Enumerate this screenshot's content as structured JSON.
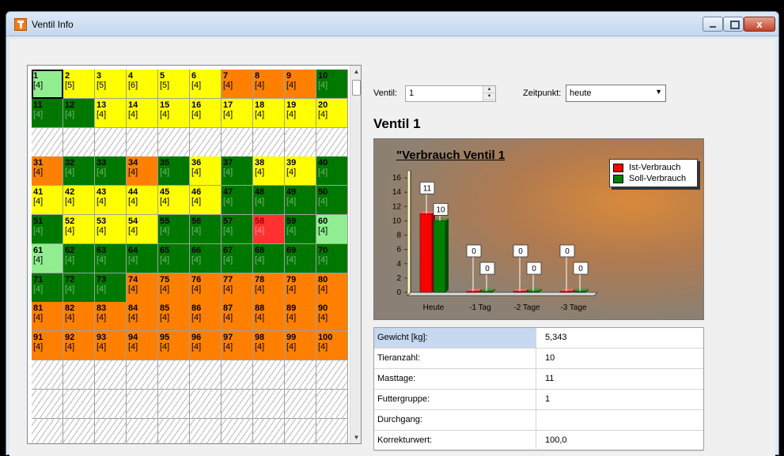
{
  "window": {
    "title": "Ventil Info",
    "close_label": "x"
  },
  "grid": {
    "rows": [
      [
        [
          "1",
          "[4]",
          "sel"
        ],
        [
          "2",
          "[5]",
          "yellow"
        ],
        [
          "3",
          "[5]",
          "yellow"
        ],
        [
          "4",
          "[6]",
          "yellow"
        ],
        [
          "5",
          "[5]",
          "yellow"
        ],
        [
          "6",
          "[4]",
          "yellow"
        ],
        [
          "7",
          "[4]",
          "orange"
        ],
        [
          "8",
          "[4]",
          "orange"
        ],
        [
          "9",
          "[4]",
          "orange"
        ],
        [
          "10",
          "[4]",
          "dgreen"
        ]
      ],
      [
        [
          "11",
          "[4]",
          "dgreen"
        ],
        [
          "12",
          "[4]",
          "dgreen"
        ],
        [
          "13",
          "[4]",
          "yellow"
        ],
        [
          "14",
          "[4]",
          "yellow"
        ],
        [
          "15",
          "[4]",
          "yellow"
        ],
        [
          "16",
          "[4]",
          "yellow"
        ],
        [
          "17",
          "[4]",
          "yellow"
        ],
        [
          "18",
          "[4]",
          "yellow"
        ],
        [
          "19",
          "[4]",
          "yellow"
        ],
        [
          "20",
          "[4]",
          "yellow"
        ]
      ],
      [
        [
          "",
          "",
          "empty"
        ],
        [
          "",
          "",
          "empty"
        ],
        [
          "",
          "",
          "empty"
        ],
        [
          "",
          "",
          "empty"
        ],
        [
          "",
          "",
          "empty"
        ],
        [
          "",
          "",
          "empty"
        ],
        [
          "",
          "",
          "empty"
        ],
        [
          "",
          "",
          "empty"
        ],
        [
          "",
          "",
          "empty"
        ],
        [
          "",
          "",
          "empty"
        ]
      ],
      [
        [
          "31",
          "[4]",
          "orange"
        ],
        [
          "32",
          "[4]",
          "dgreen"
        ],
        [
          "33",
          "[4]",
          "dgreen"
        ],
        [
          "34",
          "[4]",
          "orange"
        ],
        [
          "35",
          "[4]",
          "dgreen"
        ],
        [
          "36",
          "[4]",
          "yellow"
        ],
        [
          "37",
          "[4]",
          "dgreen"
        ],
        [
          "38",
          "[4]",
          "yellow"
        ],
        [
          "39",
          "[4]",
          "yellow"
        ],
        [
          "40",
          "[4]",
          "dgreen"
        ]
      ],
      [
        [
          "41",
          "[4]",
          "yellow"
        ],
        [
          "42",
          "[4]",
          "yellow"
        ],
        [
          "43",
          "[4]",
          "yellow"
        ],
        [
          "44",
          "[4]",
          "yellow"
        ],
        [
          "45",
          "[4]",
          "yellow"
        ],
        [
          "46",
          "[4]",
          "yellow"
        ],
        [
          "47",
          "[4]",
          "dgreen"
        ],
        [
          "48",
          "[4]",
          "dgreen"
        ],
        [
          "49",
          "[4]",
          "dgreen"
        ],
        [
          "50",
          "[4]",
          "dgreen"
        ]
      ],
      [
        [
          "51",
          "[4]",
          "dgreen"
        ],
        [
          "52",
          "[4]",
          "yellow"
        ],
        [
          "53",
          "[4]",
          "yellow"
        ],
        [
          "54",
          "[4]",
          "yellow"
        ],
        [
          "55",
          "[4]",
          "dgreen"
        ],
        [
          "56",
          "[4]",
          "dgreen"
        ],
        [
          "57",
          "[4]",
          "dgreen"
        ],
        [
          "58",
          "[4]",
          "red"
        ],
        [
          "59",
          "[4]",
          "dgreen"
        ],
        [
          "60",
          "[4]",
          "lgreen"
        ]
      ],
      [
        [
          "61",
          "[4]",
          "lgreen"
        ],
        [
          "62",
          "[4]",
          "dgreen"
        ],
        [
          "63",
          "[4]",
          "dgreen"
        ],
        [
          "64",
          "[4]",
          "dgreen"
        ],
        [
          "65",
          "[4]",
          "dgreen"
        ],
        [
          "66",
          "[4]",
          "dgreen"
        ],
        [
          "67",
          "[4]",
          "dgreen"
        ],
        [
          "68",
          "[4]",
          "dgreen"
        ],
        [
          "69",
          "[4]",
          "dgreen"
        ],
        [
          "70",
          "[4]",
          "dgreen"
        ]
      ],
      [
        [
          "71",
          "[4]",
          "dgreen"
        ],
        [
          "72",
          "[4]",
          "dgreen"
        ],
        [
          "73",
          "[4]",
          "dgreen"
        ],
        [
          "74",
          "[4]",
          "orange"
        ],
        [
          "75",
          "[4]",
          "orange"
        ],
        [
          "76",
          "[4]",
          "orange"
        ],
        [
          "77",
          "[4]",
          "orange"
        ],
        [
          "78",
          "[4]",
          "orange"
        ],
        [
          "79",
          "[4]",
          "orange"
        ],
        [
          "80",
          "[4]",
          "orange"
        ]
      ],
      [
        [
          "81",
          "[4]",
          "orange"
        ],
        [
          "82",
          "[4]",
          "orange"
        ],
        [
          "83",
          "[4]",
          "orange"
        ],
        [
          "84",
          "[4]",
          "orange"
        ],
        [
          "85",
          "[4]",
          "orange"
        ],
        [
          "86",
          "[4]",
          "orange"
        ],
        [
          "87",
          "[4]",
          "orange"
        ],
        [
          "88",
          "[4]",
          "orange"
        ],
        [
          "89",
          "[4]",
          "orange"
        ],
        [
          "90",
          "[4]",
          "orange"
        ]
      ],
      [
        [
          "91",
          "[4]",
          "orange"
        ],
        [
          "92",
          "[4]",
          "orange"
        ],
        [
          "93",
          "[4]",
          "orange"
        ],
        [
          "94",
          "[4]",
          "orange"
        ],
        [
          "95",
          "[4]",
          "orange"
        ],
        [
          "96",
          "[4]",
          "orange"
        ],
        [
          "97",
          "[4]",
          "orange"
        ],
        [
          "98",
          "[4]",
          "orange"
        ],
        [
          "99",
          "[4]",
          "orange"
        ],
        [
          "100",
          "[4]",
          "orange"
        ]
      ],
      [
        [
          "",
          "",
          "empty"
        ],
        [
          "",
          "",
          "empty"
        ],
        [
          "",
          "",
          "empty"
        ],
        [
          "",
          "",
          "empty"
        ],
        [
          "",
          "",
          "empty"
        ],
        [
          "",
          "",
          "empty"
        ],
        [
          "",
          "",
          "empty"
        ],
        [
          "",
          "",
          "empty"
        ],
        [
          "",
          "",
          "empty"
        ],
        [
          "",
          "",
          "empty"
        ]
      ],
      [
        [
          "",
          "",
          "empty"
        ],
        [
          "",
          "",
          "empty"
        ],
        [
          "",
          "",
          "empty"
        ],
        [
          "",
          "",
          "empty"
        ],
        [
          "",
          "",
          "empty"
        ],
        [
          "",
          "",
          "empty"
        ],
        [
          "",
          "",
          "empty"
        ],
        [
          "",
          "",
          "empty"
        ],
        [
          "",
          "",
          "empty"
        ],
        [
          "",
          "",
          "empty"
        ]
      ],
      [
        [
          "",
          "",
          "empty"
        ],
        [
          "",
          "",
          "empty"
        ],
        [
          "",
          "",
          "empty"
        ],
        [
          "",
          "",
          "empty"
        ],
        [
          "",
          "",
          "empty"
        ],
        [
          "",
          "",
          "empty"
        ],
        [
          "",
          "",
          "empty"
        ],
        [
          "",
          "",
          "empty"
        ],
        [
          "",
          "",
          "empty"
        ],
        [
          "",
          "",
          "empty"
        ]
      ]
    ]
  },
  "controls": {
    "ventil_label": "Ventil:",
    "ventil_value": "1",
    "zeitpunkt_label": "Zeitpunkt:",
    "zeitpunkt_value": "heute"
  },
  "heading": "Ventil 1",
  "chart_data": {
    "type": "bar",
    "title": "\"Verbrauch Ventil 1",
    "categories": [
      "Heute",
      "-1 Tag",
      "-2 Tage",
      "-3 Tage"
    ],
    "series": [
      {
        "name": "Ist-Verbrauch",
        "values": [
          11,
          0,
          0,
          0
        ],
        "color": "#ff0000"
      },
      {
        "name": "Soll-Verbrauch",
        "values": [
          10,
          0,
          0,
          0
        ],
        "color": "#008000"
      }
    ],
    "yticks": [
      0,
      2,
      4,
      6,
      8,
      10,
      12,
      14,
      16
    ],
    "ylim": [
      0,
      17
    ],
    "legend": "top-right"
  },
  "properties": [
    {
      "key": "Gewicht [kg]:",
      "value": "5,343"
    },
    {
      "key": "Tieranzahl:",
      "value": "10"
    },
    {
      "key": "Masttage:",
      "value": "11"
    },
    {
      "key": "Futtergruppe:",
      "value": "1"
    },
    {
      "key": "Durchgang:",
      "value": ""
    },
    {
      "key": "Korrekturwert:",
      "value": "100,0"
    }
  ]
}
